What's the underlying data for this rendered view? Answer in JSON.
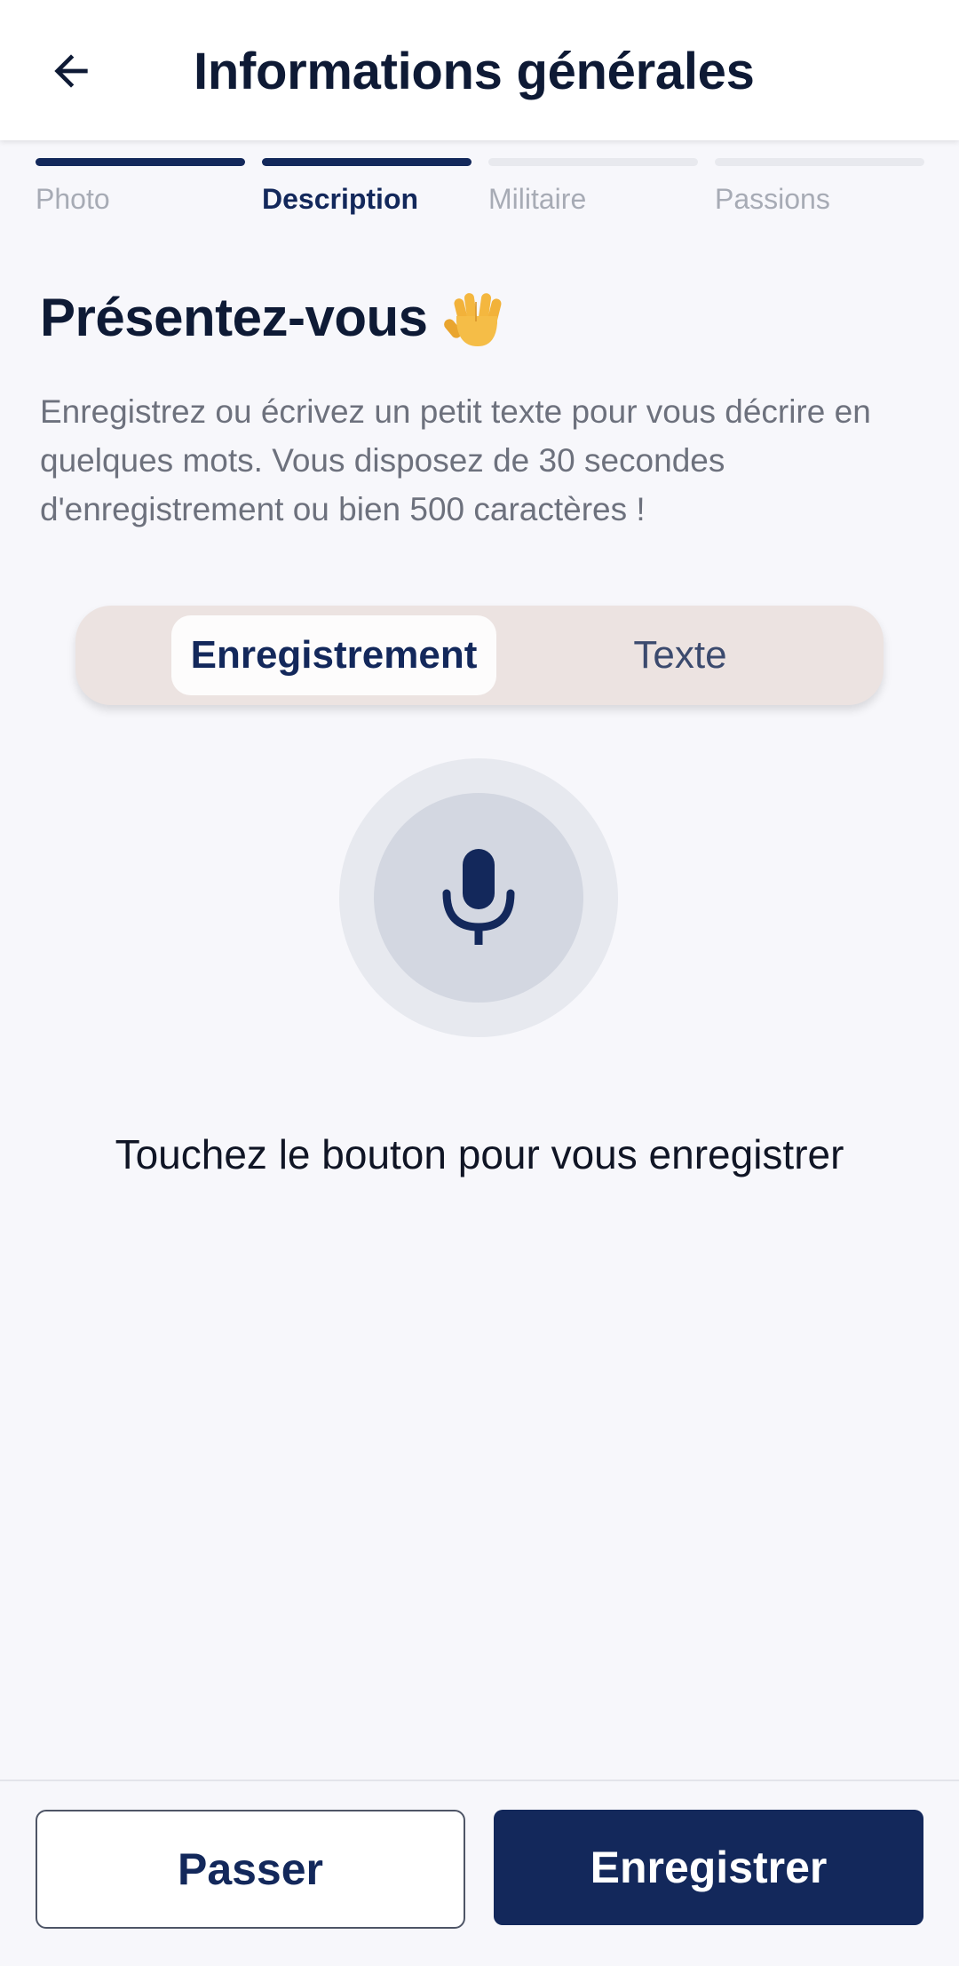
{
  "header": {
    "title": "Informations générales",
    "back_icon": "arrow-left-icon"
  },
  "stepper": {
    "steps": [
      {
        "label": "Photo",
        "state": "done"
      },
      {
        "label": "Description",
        "state": "active"
      },
      {
        "label": "Militaire",
        "state": "pending"
      },
      {
        "label": "Passions",
        "state": "pending"
      }
    ]
  },
  "section": {
    "title": "Présentez-vous",
    "title_emoji_icon": "vulcan-salute-hand-icon",
    "description": "Enregistrez ou écrivez un petit texte pour vous décrire en quelques mots. Vous disposez de 30 secondes d'enregistrement ou bien 500 caractères !"
  },
  "mode_toggle": {
    "options": [
      "Enregistrement",
      "Texte"
    ],
    "selected": "Enregistrement"
  },
  "recorder": {
    "icon": "microphone-icon",
    "hint": "Touchez le bouton pour vous enregistrer"
  },
  "footer": {
    "skip_label": "Passer",
    "save_label": "Enregistrer"
  },
  "colors": {
    "primary": "#13285b",
    "background": "#f7f7fb",
    "toggle_bg": "#ece3e1"
  }
}
